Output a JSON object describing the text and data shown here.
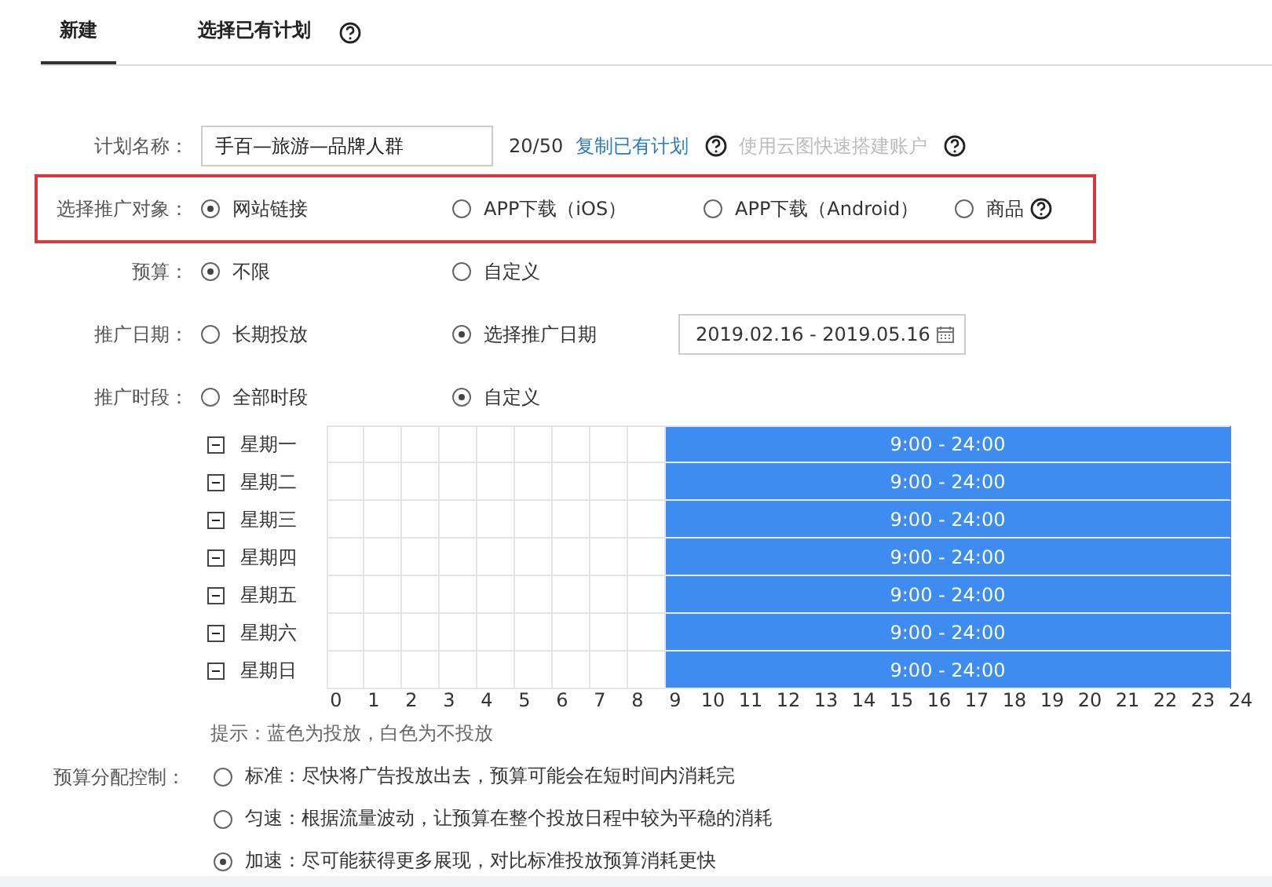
{
  "tabs": [
    {
      "label": "新建",
      "selected": true,
      "help": false
    },
    {
      "label": "选择已有计划",
      "selected": false,
      "help": true
    }
  ],
  "plan_name": {
    "label": "计划名称：",
    "value": "手百—旅游—品牌人群",
    "counter": "20/50",
    "link": "复制已有计划",
    "link_help": true,
    "secondary": "使用云图快速搭建账户",
    "secondary_disabled": true,
    "secondary_help": true
  },
  "rows": [
    {
      "label": "选择推广对象：",
      "highlighted": true,
      "options": [
        {
          "label": "网站链接",
          "selected": true,
          "help": false
        },
        {
          "label": "APP下载（iOS）",
          "selected": false,
          "help": false
        },
        {
          "label": "APP下载（Android）",
          "selected": false,
          "help": false
        },
        {
          "label": "商品",
          "selected": false,
          "help": true
        }
      ]
    },
    {
      "label": "预算：",
      "highlighted": false,
      "options": [
        {
          "label": "不限",
          "selected": true,
          "help": false
        },
        {
          "label": "自定义",
          "selected": false,
          "help": false
        }
      ]
    },
    {
      "label": "推广日期：",
      "highlighted": false,
      "options": [
        {
          "label": "长期投放",
          "selected": false,
          "help": false
        },
        {
          "label": "选择推广日期",
          "selected": true,
          "help": false
        }
      ],
      "date_field": {
        "value": "2019.02.16 - 2019.05.16"
      }
    },
    {
      "label": "推广时段：",
      "highlighted": false,
      "options": [
        {
          "label": "全部时段",
          "selected": false,
          "help": false
        },
        {
          "label": "自定义",
          "selected": true,
          "help": false
        }
      ]
    }
  ],
  "schedule": {
    "days": [
      {
        "label": "星期一",
        "partial": true,
        "slots": [
          {
            "selected": false
          },
          {
            "selected": false
          },
          {
            "selected": false
          },
          {
            "selected": false
          },
          {
            "selected": false
          },
          {
            "selected": false
          },
          {
            "selected": false
          },
          {
            "selected": false
          },
          {
            "selected": false
          },
          {
            "selected": true,
            "label": "9:00 - 24:00"
          }
        ]
      },
      {
        "label": "星期二",
        "partial": true,
        "slots": [
          {
            "selected": false
          },
          {
            "selected": false
          },
          {
            "selected": false
          },
          {
            "selected": false
          },
          {
            "selected": false
          },
          {
            "selected": false
          },
          {
            "selected": false
          },
          {
            "selected": false
          },
          {
            "selected": false
          },
          {
            "selected": true,
            "label": "9:00 - 24:00"
          }
        ]
      },
      {
        "label": "星期三",
        "partial": true,
        "slots": [
          {
            "selected": false
          },
          {
            "selected": false
          },
          {
            "selected": false
          },
          {
            "selected": false
          },
          {
            "selected": false
          },
          {
            "selected": false
          },
          {
            "selected": false
          },
          {
            "selected": false
          },
          {
            "selected": false
          },
          {
            "selected": true,
            "label": "9:00 - 24:00"
          }
        ]
      },
      {
        "label": "星期四",
        "partial": true,
        "slots": [
          {
            "selected": false
          },
          {
            "selected": false
          },
          {
            "selected": false
          },
          {
            "selected": false
          },
          {
            "selected": false
          },
          {
            "selected": false
          },
          {
            "selected": false
          },
          {
            "selected": false
          },
          {
            "selected": false
          },
          {
            "selected": true,
            "label": "9:00 - 24:00"
          }
        ]
      },
      {
        "label": "星期五",
        "partial": true,
        "slots": [
          {
            "selected": false
          },
          {
            "selected": false
          },
          {
            "selected": false
          },
          {
            "selected": false
          },
          {
            "selected": false
          },
          {
            "selected": false
          },
          {
            "selected": false
          },
          {
            "selected": false
          },
          {
            "selected": false
          },
          {
            "selected": true,
            "label": "9:00 - 24:00"
          }
        ]
      },
      {
        "label": "星期六",
        "partial": true,
        "slots": [
          {
            "selected": false
          },
          {
            "selected": false
          },
          {
            "selected": false
          },
          {
            "selected": false
          },
          {
            "selected": false
          },
          {
            "selected": false
          },
          {
            "selected": false
          },
          {
            "selected": false
          },
          {
            "selected": false
          },
          {
            "selected": true,
            "label": "9:00 - 24:00"
          }
        ]
      },
      {
        "label": "星期日",
        "partial": true,
        "slots": [
          {
            "selected": false
          },
          {
            "selected": false
          },
          {
            "selected": false
          },
          {
            "selected": false
          },
          {
            "selected": false
          },
          {
            "selected": false
          },
          {
            "selected": false
          },
          {
            "selected": false
          },
          {
            "selected": false
          },
          {
            "selected": true,
            "label": "9:00 - 24:00"
          }
        ]
      }
    ],
    "hours": [
      "0",
      "1",
      "2",
      "3",
      "4",
      "5",
      "6",
      "7",
      "8",
      "9",
      "10",
      "11",
      "12",
      "13",
      "14",
      "15",
      "16",
      "17",
      "18",
      "19",
      "20",
      "21",
      "22",
      "23",
      "24"
    ],
    "tip": "提示：蓝色为投放，白色为不投放"
  },
  "budget_control": {
    "label": "预算分配控制：",
    "options": [
      {
        "label": "标准：尽快将广告投放出去，预算可能会在短时间内消耗完",
        "selected": false
      },
      {
        "label": "匀速：根据流量波动，让预算在整个投放日程中较为平稳的消耗",
        "selected": false
      },
      {
        "label": "加速：尽可能获得更多展现，对比标准投放预算消耗更快",
        "selected": true
      }
    ]
  }
}
